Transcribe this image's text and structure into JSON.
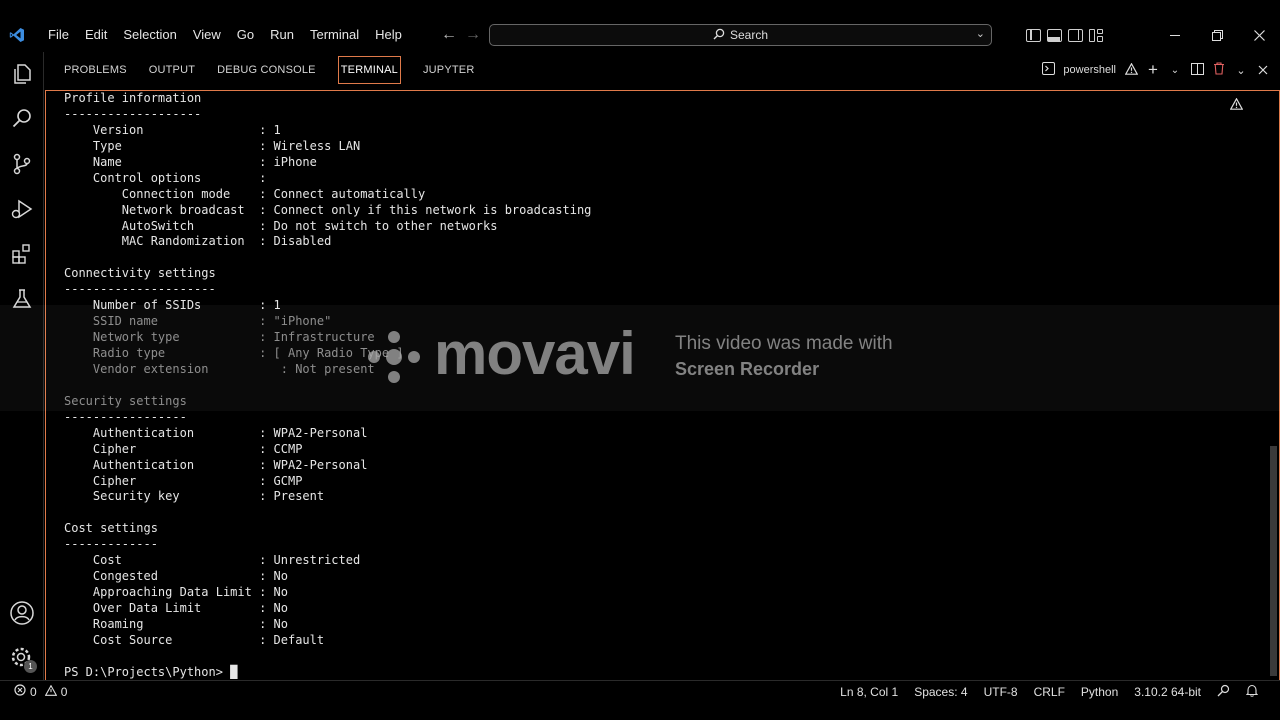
{
  "menu": [
    "File",
    "Edit",
    "Selection",
    "View",
    "Go",
    "Run",
    "Terminal",
    "Help"
  ],
  "search": {
    "label": "Search"
  },
  "panel": {
    "tabs": [
      "PROBLEMS",
      "OUTPUT",
      "DEBUG CONSOLE",
      "TERMINAL",
      "JUPYTER"
    ],
    "active_tab": "TERMINAL",
    "shell_label": "powershell"
  },
  "terminal": {
    "lines": [
      {
        "text": "Profile information",
        "faded": false
      },
      {
        "text": "-------------------",
        "faded": false
      },
      {
        "text": "    Version                : 1",
        "faded": false
      },
      {
        "text": "    Type                   : Wireless LAN",
        "faded": false
      },
      {
        "text": "    Name                   : iPhone",
        "faded": false
      },
      {
        "text": "    Control options        :",
        "faded": false
      },
      {
        "text": "        Connection mode    : Connect automatically",
        "faded": false
      },
      {
        "text": "        Network broadcast  : Connect only if this network is broadcasting",
        "faded": false
      },
      {
        "text": "        AutoSwitch         : Do not switch to other networks",
        "faded": false
      },
      {
        "text": "        MAC Randomization  : Disabled",
        "faded": false
      },
      {
        "text": "",
        "faded": false
      },
      {
        "text": "Connectivity settings",
        "faded": false
      },
      {
        "text": "---------------------",
        "faded": false
      },
      {
        "text": "    Number of SSIDs        : 1",
        "faded": false
      },
      {
        "text": "    SSID name              : \"iPhone\"",
        "faded": true
      },
      {
        "text": "    Network type           : Infrastructure",
        "faded": true
      },
      {
        "text": "    Radio type             : [ Any Radio Type ]",
        "faded": true
      },
      {
        "text": "    Vendor extension          : Not present",
        "faded": true
      },
      {
        "text": "",
        "faded": false
      },
      {
        "text": "Security settings",
        "faded": true
      },
      {
        "text": "-----------------",
        "faded": false
      },
      {
        "text": "    Authentication         : WPA2-Personal",
        "faded": false
      },
      {
        "text": "    Cipher                 : CCMP",
        "faded": false
      },
      {
        "text": "    Authentication         : WPA2-Personal",
        "faded": false
      },
      {
        "text": "    Cipher                 : GCMP",
        "faded": false
      },
      {
        "text": "    Security key           : Present",
        "faded": false
      },
      {
        "text": "",
        "faded": false
      },
      {
        "text": "Cost settings",
        "faded": false
      },
      {
        "text": "-------------",
        "faded": false
      },
      {
        "text": "    Cost                   : Unrestricted",
        "faded": false
      },
      {
        "text": "    Congested              : No",
        "faded": false
      },
      {
        "text": "    Approaching Data Limit : No",
        "faded": false
      },
      {
        "text": "    Over Data Limit        : No",
        "faded": false
      },
      {
        "text": "    Roaming                : No",
        "faded": false
      },
      {
        "text": "    Cost Source            : Default",
        "faded": false
      },
      {
        "text": "",
        "faded": false
      },
      {
        "text": "PS D:\\Projects\\Python> █",
        "faded": false
      }
    ]
  },
  "watermark": {
    "brand": "movavi",
    "caption_line1": "This video was made with",
    "caption_line2": "Screen Recorder"
  },
  "status": {
    "errors": "0",
    "warnings": "0",
    "position": "Ln 8, Col 1",
    "spaces": "Spaces: 4",
    "encoding": "UTF-8",
    "eol": "CRLF",
    "language": "Python",
    "interpreter": "3.10.2 64-bit",
    "settings_badge": "1"
  },
  "colors": {
    "accent": "#e07a4a",
    "vscode_blue": "#3c8de0"
  }
}
